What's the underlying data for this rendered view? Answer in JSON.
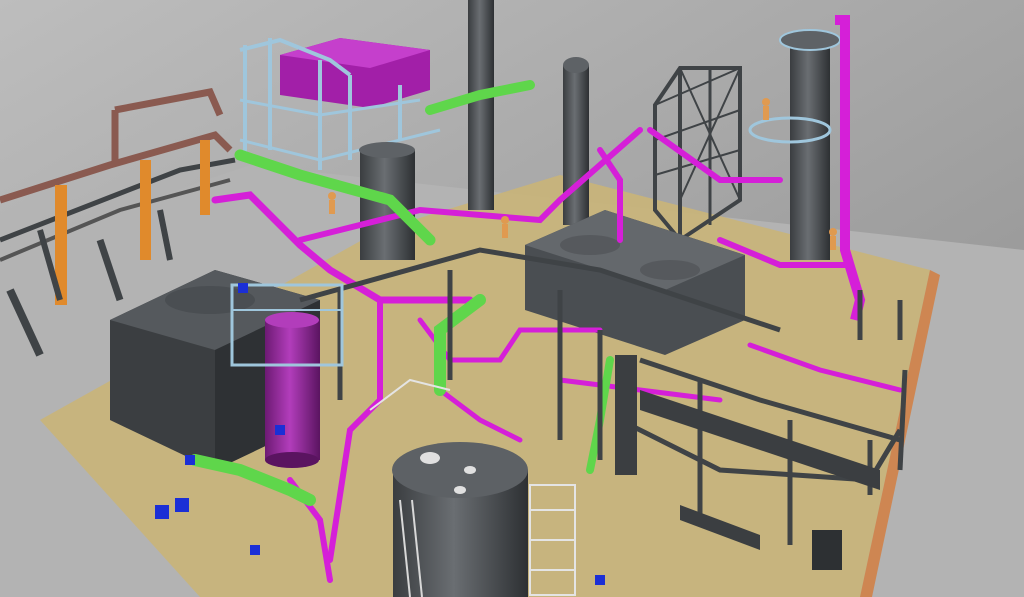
{
  "scene": {
    "kind": "3d-plant-model-view",
    "colors": {
      "background": "#9e9e9e",
      "ground": "#c9b47a",
      "steel": "#3f4346",
      "vessel": "#505458",
      "pipe_magenta": "#d51fd8",
      "pipe_green": "#5fd64b",
      "pipe_rust": "#8a5a50",
      "structure_cyan": "#9fc6dc",
      "support_orange": "#e08a2c",
      "valve_blue": "#1b2fd6"
    },
    "icons": [
      "stack-icon",
      "column-icon",
      "tank-icon",
      "vessel-icon",
      "worker-icon",
      "valve-icon"
    ]
  }
}
